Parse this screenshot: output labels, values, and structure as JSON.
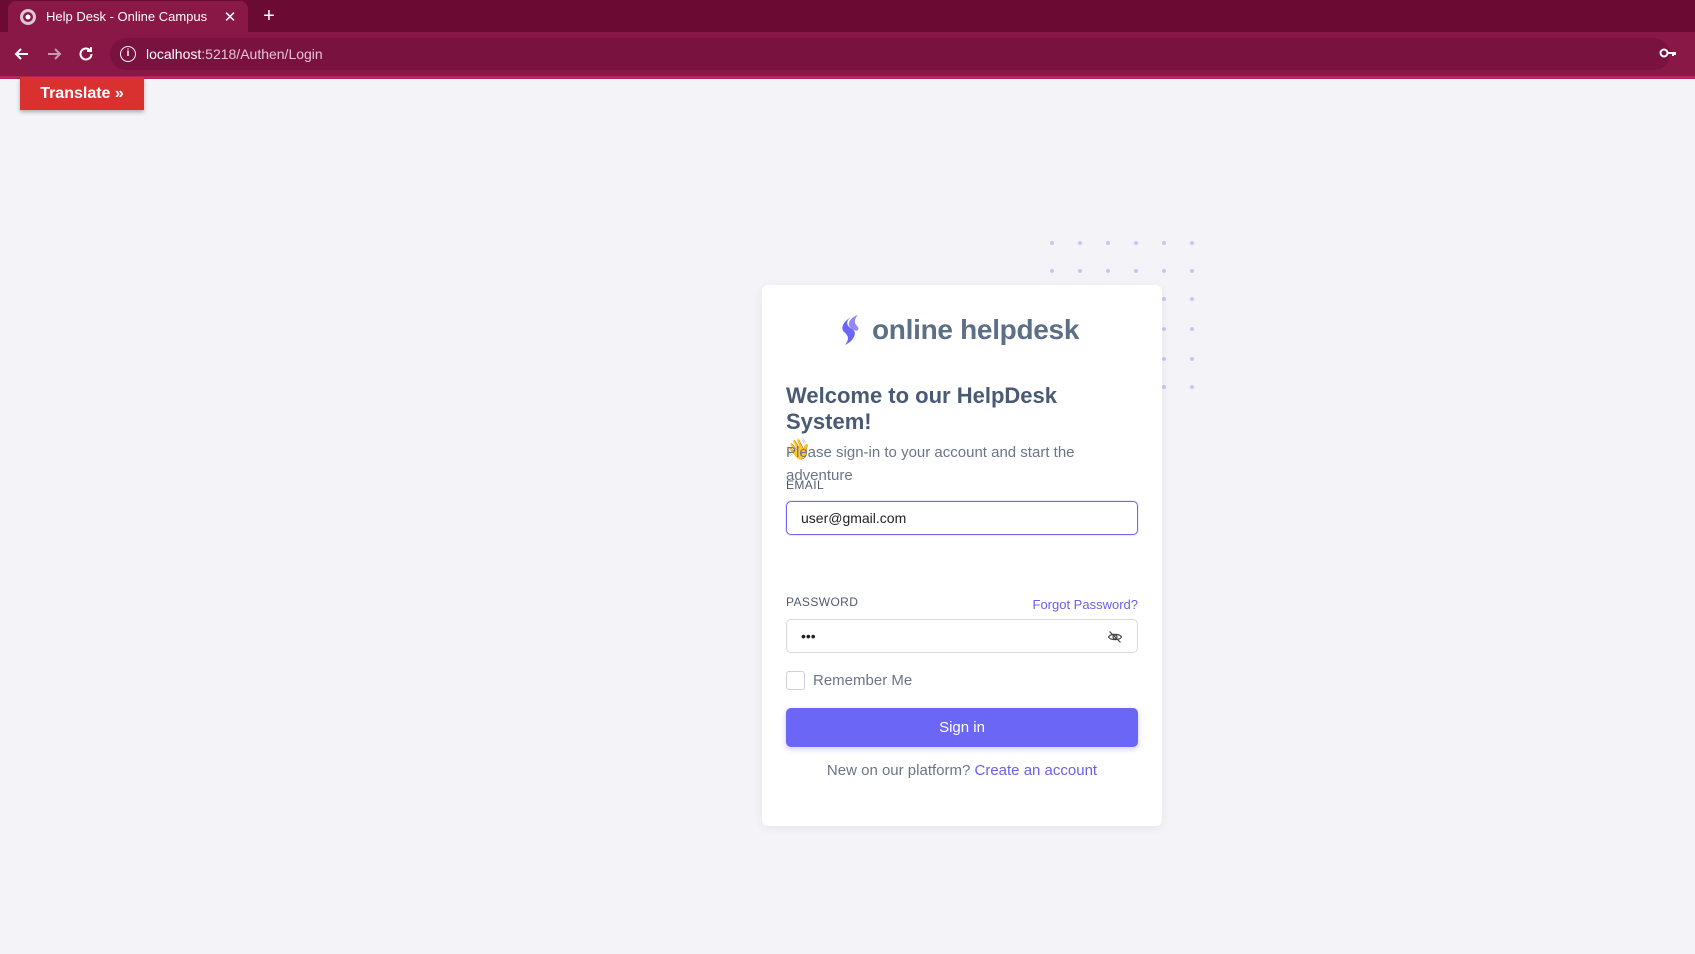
{
  "browser": {
    "tab_title": "Help Desk - Online Campus",
    "url_host": "localhost",
    "url_path": ":5218/Authen/Login"
  },
  "translate": {
    "label": "Translate »"
  },
  "brand": {
    "name": "online helpdesk"
  },
  "login": {
    "welcome": "Welcome to our HelpDesk System!",
    "wave": "👋",
    "subtitle": "Please sign-in to your account and start the adventure",
    "email_label": "EMAIL",
    "email_value": "user@gmail.com",
    "password_label": "PASSWORD",
    "forgot": "Forgot Password?",
    "password_value": "•••",
    "remember": "Remember Me",
    "signin": "Sign in",
    "new_text": "New on our platform?",
    "create_link": "Create an account"
  },
  "colors": {
    "tabbar": "#6b0b34",
    "toolbar": "#8a1847",
    "accent": "#6b66f5",
    "translate": "#d9312f"
  }
}
